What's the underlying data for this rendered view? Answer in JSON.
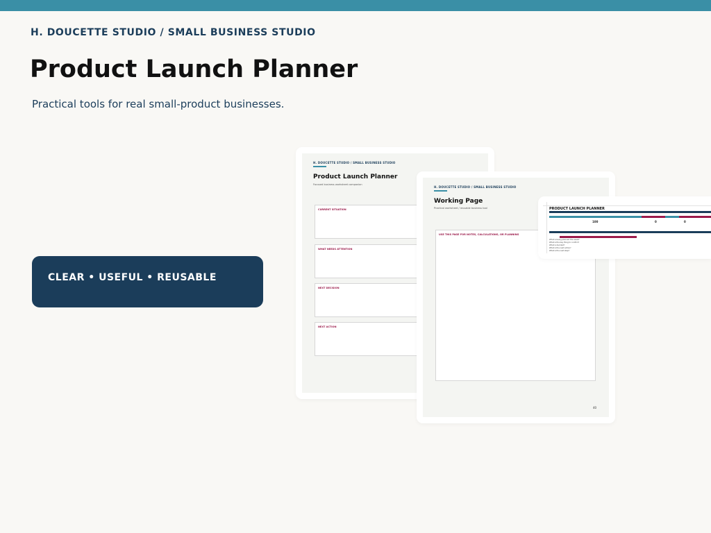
{
  "brand": "H. DOUCETTE STUDIO / SMALL BUSINESS STUDIO",
  "title": "Product Launch Planner",
  "subtitle": "Practical tools for real small-product businesses.",
  "tagline": "CLEAR • USEFUL • REUSABLE",
  "colors": {
    "accent": "#3a8fa6",
    "navy": "#1b3d5a",
    "crimson": "#9b1a4a"
  },
  "preview_main": {
    "brand": "H. DOUCETTE STUDIO / SMALL BUSINESS STUDIO",
    "title": "Product Launch Planner",
    "subtitle": "Focused business worksheet companion",
    "sections": [
      "CURRENT SITUATION",
      "WHAT NEEDS ATTENTION",
      "NEXT DECISION",
      "NEXT ACTION"
    ]
  },
  "preview_working": {
    "brand": "H. DOUCETTE STUDIO / SMALL BUSINESS STUDIO",
    "title": "Working Page",
    "subtitle": "Practical worksheet / reusable business tool",
    "box_label": "USE THIS PAGE FOR NOTES, CALCULATIONS, OR PLANNING",
    "page_number": "40"
  },
  "preview_sheet": {
    "title": "PRODUCT LAUNCH PLANNER",
    "values": [
      "100",
      "0",
      "0"
    ],
    "rows": [
      "What is being planned this week?",
      "What is the key thing to confirm?",
      "What is decided?",
      "What is the next action?",
      "What is the next step?"
    ]
  }
}
